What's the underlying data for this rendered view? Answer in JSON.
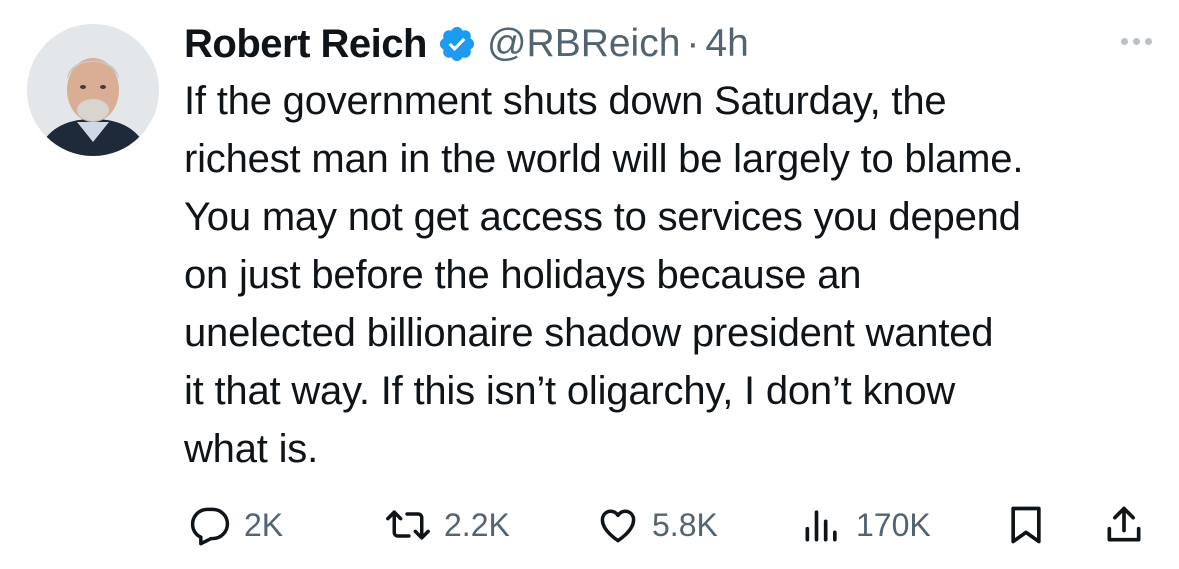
{
  "author": {
    "display_name": "Robert Reich",
    "handle": "@RBReich",
    "separator": "·",
    "time": "4h",
    "verified": true
  },
  "tweet": {
    "lines": [
      "If the government shuts down Saturday, the",
      "richest man in the world will be largely to blame.",
      "You may not get access to services you depend",
      "on just before the holidays because an",
      "unelected billionaire shadow president wanted",
      "it that way. If this isn’t oligarchy, I don’t know",
      "what is."
    ]
  },
  "actions": {
    "replies": "2K",
    "reposts": "2.2K",
    "likes": "5.8K",
    "views": "170K"
  },
  "icons": {
    "verified": "verified-badge-icon",
    "more": "more-icon",
    "reply": "reply-icon",
    "repost": "repost-icon",
    "like": "heart-icon",
    "views": "views-chart-icon",
    "bookmark": "bookmark-icon",
    "share": "share-icon"
  },
  "colors": {
    "text": "#0f1419",
    "secondary": "#536471",
    "verified": "#1d9bf0"
  }
}
